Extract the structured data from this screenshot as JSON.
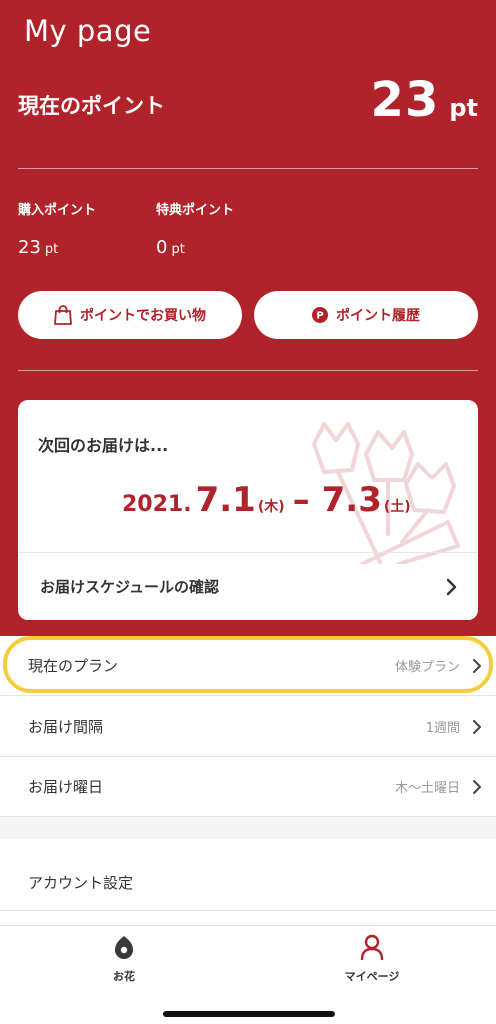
{
  "header": {
    "title": "My page",
    "current_points_label": "現在のポイント",
    "current_points_value": "23",
    "current_points_unit": "pt",
    "purchase_points_label": "購入ポイント",
    "purchase_points_value": "23",
    "purchase_points_unit": "pt",
    "bonus_points_label": "特典ポイント",
    "bonus_points_value": "0",
    "bonus_points_unit": "pt",
    "shop_button_label": "ポイントでお買い物",
    "history_button_label": "ポイント履歴",
    "history_button_icon_letter": "P"
  },
  "delivery_card": {
    "heading": "次回のお届けは...",
    "year": "2021.",
    "start_date": "7.1",
    "start_dow": "(木)",
    "separator": "–",
    "end_date": "7.3",
    "end_dow": "(土)",
    "schedule_link_label": "お届けスケジュールの確認"
  },
  "settings": {
    "rows": [
      {
        "label": "現在のプラン",
        "value": "体験プラン"
      },
      {
        "label": "お届け間隔",
        "value": "1週間"
      },
      {
        "label": "お届け曜日",
        "value": "木〜土曜日"
      }
    ],
    "account_label": "アカウント設定"
  },
  "tabbar": {
    "tabs": [
      {
        "label": "お花",
        "icon": "flower-icon"
      },
      {
        "label": "マイページ",
        "icon": "person-icon"
      }
    ]
  },
  "colors": {
    "brand_red": "#b0232a",
    "highlight_yellow": "#f2cf3a",
    "active_tab_red": "#b0232a"
  }
}
